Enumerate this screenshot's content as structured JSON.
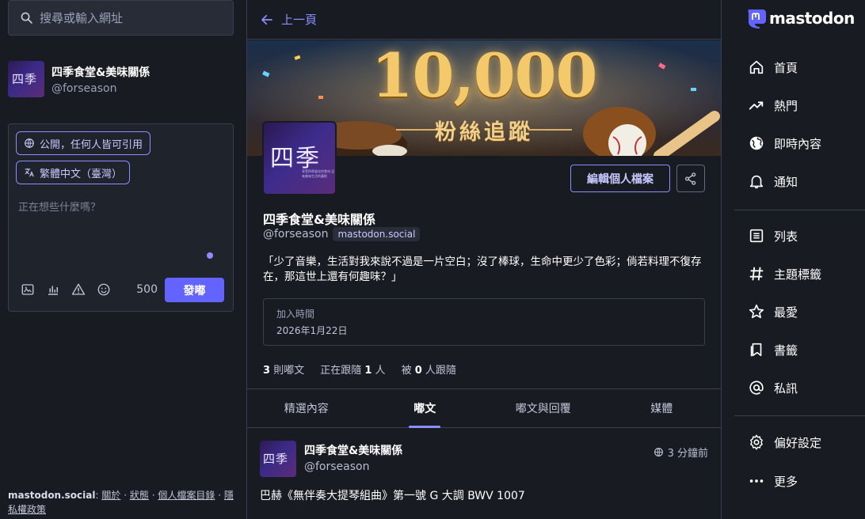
{
  "search": {
    "placeholder": "搜尋或輸入網址"
  },
  "account": {
    "name": "四季食堂&美味關係",
    "handle": "@forseason",
    "avatar_text": "四季"
  },
  "compose": {
    "visibility_label": "公開，任何人皆可引用",
    "language_label": "繁體中文（臺灣）",
    "placeholder": "正在想些什麼嗎？",
    "char_count": "500",
    "post_label": "發嘟"
  },
  "footer": {
    "site": "mastodon.social",
    "colon": ":",
    "links": [
      "關於",
      "狀態",
      "個人檔案目錄",
      "隱私權政策"
    ],
    "separator": "·"
  },
  "profile": {
    "back_label": "上一頁",
    "header_big": "10,000",
    "header_sub": "粉絲追蹤",
    "avatar_text": "四季",
    "avatar_small_text": "享受四季變化的食材 品味美味生活的藝術",
    "edit_label": "編輯個人檔案",
    "display_name": "四季食堂&美味關係",
    "handle": "@forseason",
    "domain": "mastodon.social",
    "bio": "「少了音樂，生活對我來說不過是一片空白；沒了棒球，生命中更少了色彩；倘若料理不復存在，那這世上還有何趣味？」",
    "joined_label": "加入時間",
    "joined_value": "2026年1月22日",
    "stats": {
      "posts_count": "3",
      "posts_label": "則嘟文",
      "following_prefix": "正在跟隨",
      "following_count": "1",
      "following_suffix": "人",
      "followers_prefix": "被",
      "followers_count": "0",
      "followers_suffix": "人跟隨"
    },
    "tabs": [
      {
        "label": "精選內容",
        "active": false
      },
      {
        "label": "嘟文",
        "active": true
      },
      {
        "label": "嘟文與回覆",
        "active": false
      },
      {
        "label": "媒體",
        "active": false
      }
    ]
  },
  "status": {
    "name": "四季食堂&美味關係",
    "handle": "@forseason",
    "avatar_text": "四季",
    "time": "3 分鐘前",
    "text": "巴赫《無伴奏大提琴組曲》第一號 G 大調 BWV 1007"
  },
  "nav": {
    "brand": "mastodon",
    "items": [
      {
        "label": "首頁",
        "icon": "home-icon"
      },
      {
        "label": "熱門",
        "icon": "trending-icon"
      },
      {
        "label": "即時內容",
        "icon": "globe-icon"
      },
      {
        "label": "通知",
        "icon": "bell-icon"
      },
      {
        "label": "列表",
        "icon": "list-icon"
      },
      {
        "label": "主題標籤",
        "icon": "hashtag-icon"
      },
      {
        "label": "最愛",
        "icon": "star-icon"
      },
      {
        "label": "書籤",
        "icon": "bookmark-icon"
      },
      {
        "label": "私訊",
        "icon": "at-icon"
      },
      {
        "label": "偏好設定",
        "icon": "gear-icon"
      },
      {
        "label": "更多",
        "icon": "more-icon"
      }
    ]
  },
  "colors": {
    "accent": "#6364ff",
    "accent_text": "#8c8dff",
    "background": "#191b22",
    "border": "#393f4f"
  }
}
